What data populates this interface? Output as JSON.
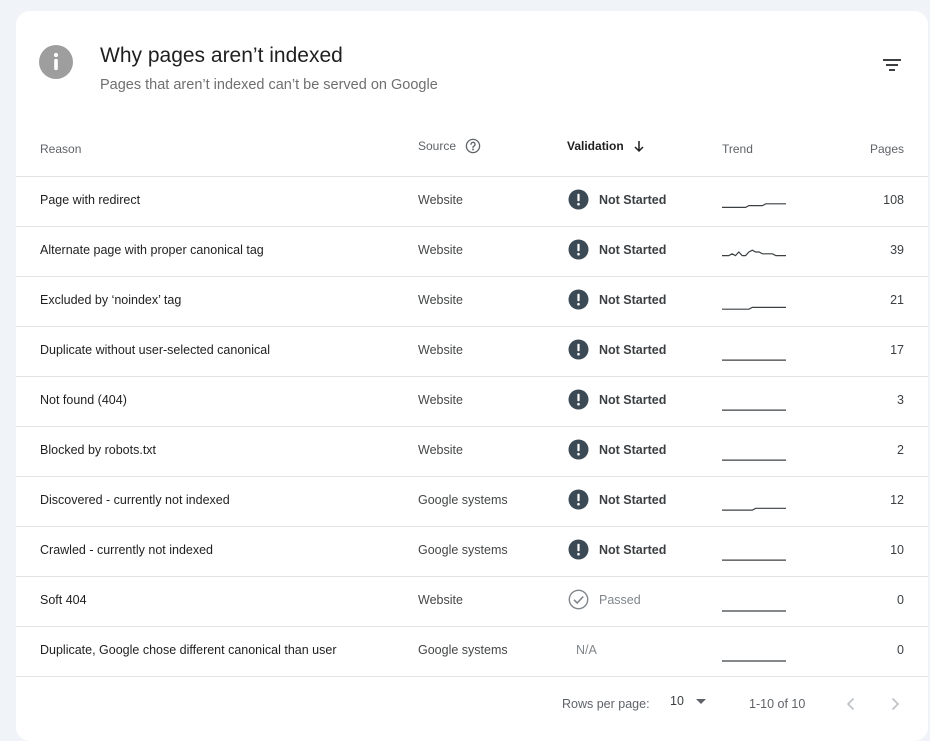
{
  "header": {
    "title": "Why pages aren’t indexed",
    "subtitle": "Pages that aren’t indexed can’t be served on Google",
    "info_icon": "info-icon",
    "filter_icon": "filter-icon"
  },
  "columns": {
    "reason": "Reason",
    "source": "Source",
    "validation": "Validation",
    "trend": "Trend",
    "pages": "Pages"
  },
  "rows": [
    {
      "reason": "Page with redirect",
      "source": "Website",
      "validation": "Not Started",
      "status": "not-started",
      "pages": "108",
      "trend": [
        0.2,
        0.2,
        0.2,
        0.2,
        0.2,
        0.2,
        0.2,
        0.2,
        0.3,
        0.3,
        0.3,
        0.3,
        0.3,
        0.4,
        0.4,
        0.4,
        0.4,
        0.4,
        0.4,
        0.4
      ]
    },
    {
      "reason": "Alternate page with proper canonical tag",
      "source": "Website",
      "validation": "Not Started",
      "status": "not-started",
      "pages": "39",
      "trend": [
        0.3,
        0.3,
        0.3,
        0.4,
        0.3,
        0.5,
        0.3,
        0.3,
        0.5,
        0.6,
        0.5,
        0.5,
        0.4,
        0.4,
        0.4,
        0.4,
        0.3,
        0.3,
        0.3,
        0.3
      ]
    },
    {
      "reason": "Excluded by ‘noindex’ tag",
      "source": "Website",
      "validation": "Not Started",
      "status": "not-started",
      "pages": "21",
      "trend": [
        0.1,
        0.1,
        0.1,
        0.1,
        0.1,
        0.1,
        0.1,
        0.1,
        0.1,
        0.2,
        0.2,
        0.2,
        0.2,
        0.2,
        0.2,
        0.2,
        0.2,
        0.2,
        0.2,
        0.2
      ]
    },
    {
      "reason": "Duplicate without user-selected canonical",
      "source": "Website",
      "validation": "Not Started",
      "status": "not-started",
      "pages": "17",
      "trend": [
        0.05,
        0.05,
        0.05,
        0.05,
        0.05,
        0.05,
        0.05,
        0.05,
        0.05,
        0.05,
        0.05,
        0.05,
        0.05,
        0.05,
        0.05,
        0.05,
        0.05,
        0.05,
        0.05,
        0.05
      ]
    },
    {
      "reason": "Not found (404)",
      "source": "Website",
      "validation": "Not Started",
      "status": "not-started",
      "pages": "3",
      "trend": [
        0.05,
        0.05,
        0.05,
        0.05,
        0.05,
        0.05,
        0.05,
        0.05,
        0.05,
        0.05,
        0.05,
        0.05,
        0.05,
        0.05,
        0.05,
        0.05,
        0.05,
        0.05,
        0.05,
        0.05
      ]
    },
    {
      "reason": "Blocked by robots.txt",
      "source": "Website",
      "validation": "Not Started",
      "status": "not-started",
      "pages": "2",
      "trend": [
        0.05,
        0.05,
        0.05,
        0.05,
        0.05,
        0.05,
        0.05,
        0.05,
        0.05,
        0.05,
        0.05,
        0.05,
        0.05,
        0.05,
        0.05,
        0.05,
        0.05,
        0.05,
        0.05,
        0.05
      ]
    },
    {
      "reason": "Discovered - currently not indexed",
      "source": "Google systems",
      "validation": "Not Started",
      "status": "not-started",
      "pages": "12",
      "trend": [
        0.05,
        0.05,
        0.05,
        0.05,
        0.05,
        0.05,
        0.05,
        0.05,
        0.05,
        0.05,
        0.15,
        0.15,
        0.15,
        0.15,
        0.15,
        0.15,
        0.15,
        0.15,
        0.15,
        0.15
      ]
    },
    {
      "reason": "Crawled - currently not indexed",
      "source": "Google systems",
      "validation": "Not Started",
      "status": "not-started",
      "pages": "10",
      "trend": [
        0.05,
        0.05,
        0.05,
        0.05,
        0.05,
        0.05,
        0.05,
        0.05,
        0.05,
        0.05,
        0.05,
        0.05,
        0.05,
        0.05,
        0.05,
        0.05,
        0.05,
        0.05,
        0.05,
        0.05
      ]
    },
    {
      "reason": "Soft 404",
      "source": "Website",
      "validation": "Passed",
      "status": "passed",
      "pages": "0",
      "trend": [
        0.0,
        0.0,
        0.0,
        0.0,
        0.0,
        0.0,
        0.0,
        0.0,
        0.0,
        0.0,
        0.0,
        0.0,
        0.0,
        0.0,
        0.0,
        0.0,
        0.0,
        0.0,
        0.0,
        0.0
      ]
    },
    {
      "reason": "Duplicate, Google chose different canonical than user",
      "source": "Google systems",
      "validation": "N/A",
      "status": "na",
      "pages": "0",
      "trend": [
        0.0,
        0.0,
        0.0,
        0.0,
        0.0,
        0.0,
        0.0,
        0.0,
        0.0,
        0.0,
        0.0,
        0.0,
        0.0,
        0.0,
        0.0,
        0.0,
        0.0,
        0.0,
        0.0,
        0.0
      ]
    }
  ],
  "pagination": {
    "rows_per_page_label": "Rows per page:",
    "rows_per_page_value": "10",
    "range": "1-10 of 10"
  },
  "colors": {
    "not_started": "#3c4a55",
    "passed": "#80868b",
    "trend_line": "#3c4043"
  }
}
